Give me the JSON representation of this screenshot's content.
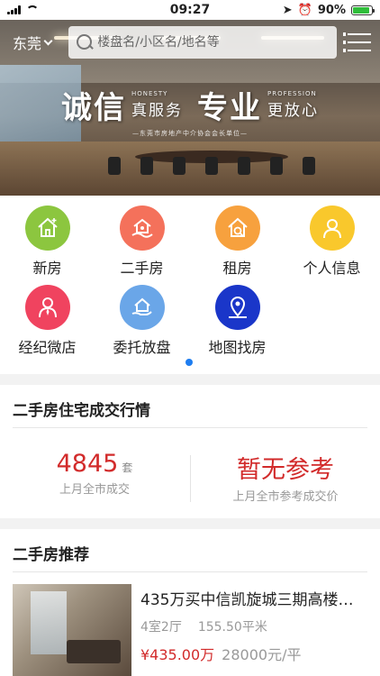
{
  "status_bar": {
    "time": "09:27",
    "battery": "90%",
    "battery_level": 0.9,
    "icons": [
      "signal-icon",
      "wifi-icon",
      "location-arrow-icon",
      "alarm-icon",
      "battery-icon"
    ]
  },
  "banner": {
    "slogan_left": "诚信",
    "slogan_left_en": "HONESTY",
    "slogan_left_cn": "真服务",
    "slogan_right": "专业",
    "slogan_right_en": "PROFESSION",
    "slogan_right_cn": "更放心",
    "slogan_sub": "—东莞市房地产中介协会会长单位—"
  },
  "header": {
    "city": "东莞",
    "search_placeholder": "楼盘名/小区名/地名等"
  },
  "quick_menu": [
    {
      "label": "新房",
      "color": "#8cc63f",
      "icon": "new-house-icon"
    },
    {
      "label": "二手房",
      "color": "#f4715b",
      "icon": "second-hand-house-icon"
    },
    {
      "label": "租房",
      "color": "#f7a13e",
      "icon": "rent-icon"
    },
    {
      "label": "个人信息",
      "color": "#f9c82c",
      "icon": "person-icon"
    },
    {
      "label": "经纪微店",
      "color": "#f0435f",
      "icon": "agent-icon"
    },
    {
      "label": "委托放盘",
      "color": "#6aa6e8",
      "icon": "consign-icon"
    },
    {
      "label": "地图找房",
      "color": "#1a36c9",
      "icon": "map-pin-icon"
    }
  ],
  "transactions": {
    "title": "二手房住宅成交行情",
    "count_value": "4845",
    "count_unit": "套",
    "count_caption": "上月全市成交",
    "price_value": "暂无参考",
    "price_caption": "上月全市参考成交价"
  },
  "recommend": {
    "title": "二手房推荐",
    "listings": [
      {
        "title": "435万买中信凯旋城三期高楼层...",
        "layout": "4室2厅",
        "area": "155.50平米",
        "total_price": "¥435.00万",
        "unit_price": "28000元/平"
      }
    ]
  },
  "colors": {
    "accent_red": "#d22b2b",
    "page_indicator": "#1e7df0"
  }
}
